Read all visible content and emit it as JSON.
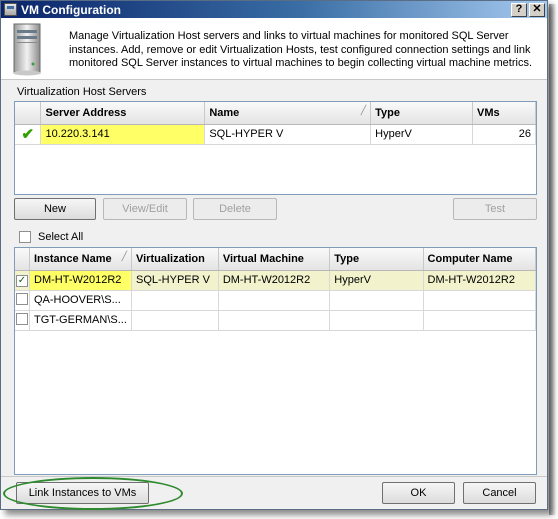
{
  "window": {
    "title": "VM Configuration",
    "help_glyph": "?",
    "close_glyph": "✕"
  },
  "header": {
    "description": "Manage Virtualization Host servers and links to virtual machines for monitored SQL Server instances. Add, remove or edit Virtualization Hosts, test configured connection settings and link monitored SQL Server instances to virtual machines to begin collecting virtual machine metrics.",
    "icon": "server-icon"
  },
  "hosts": {
    "group_label": "Virtualization Host Servers",
    "columns": [
      "Server Address",
      "Name",
      "Type",
      "VMs"
    ],
    "rows": [
      {
        "status_icon": "check-icon",
        "server_address": "10.220.3.141",
        "name": "SQL-HYPER V",
        "type": "HyperV",
        "vms": "26"
      }
    ]
  },
  "host_buttons": {
    "new": "New",
    "view_edit": "View/Edit",
    "delete": "Delete",
    "test": "Test"
  },
  "select_all_label": "Select All",
  "instances": {
    "columns": [
      "Instance Name",
      "Virtualization",
      "Virtual Machine",
      "Type",
      "Computer Name"
    ],
    "rows": [
      {
        "checked": true,
        "instance_name": "DM-HT-W2012R2",
        "virtualization": "SQL-HYPER V",
        "virtual_machine": "DM-HT-W2012R2",
        "type": "HyperV",
        "computer_name": "DM-HT-W2012R2"
      },
      {
        "checked": false,
        "instance_name": "QA-HOOVER\\S...",
        "virtualization": "",
        "virtual_machine": "",
        "type": "",
        "computer_name": ""
      },
      {
        "checked": false,
        "instance_name": "TGT-GERMAN\\S...",
        "virtualization": "",
        "virtual_machine": "",
        "type": "",
        "computer_name": ""
      }
    ]
  },
  "footer": {
    "link_button": "Link Instances to VMs",
    "ok": "OK",
    "cancel": "Cancel"
  },
  "colors": {
    "highlight": "#ffff66",
    "annotation": "#2d8a2d",
    "check": "#2ea000"
  }
}
